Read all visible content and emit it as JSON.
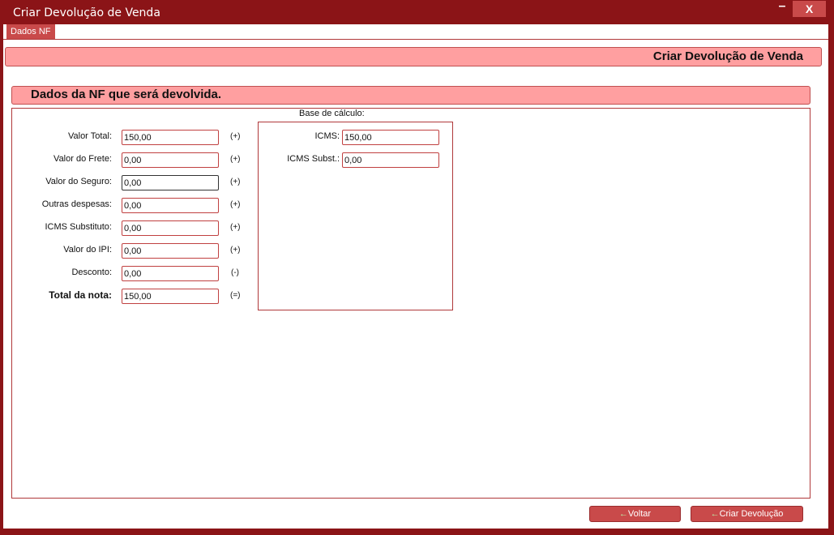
{
  "window": {
    "title": "Criar Devolução de Venda",
    "minimize": "–",
    "close": "X"
  },
  "tabs": [
    {
      "label": "Dados NF"
    }
  ],
  "header": {
    "title": "Criar Devolução de Venda"
  },
  "section": {
    "title": "Dados da NF que será devolvida."
  },
  "fields": [
    {
      "label": "Valor Total:",
      "value": "150,00",
      "op": "(+)"
    },
    {
      "label": "Valor do Frete:",
      "value": "0,00",
      "op": "(+)"
    },
    {
      "label": "Valor do Seguro:",
      "value": "0,00",
      "op": "(+)"
    },
    {
      "label": "Outras despesas:",
      "value": "0,00",
      "op": "(+)"
    },
    {
      "label": "ICMS Substituto:",
      "value": "0,00",
      "op": "(+)"
    },
    {
      "label": "Valor do IPI:",
      "value": "0,00",
      "op": "(+)"
    },
    {
      "label": "Desconto:",
      "value": "0,00",
      "op": "(-)"
    },
    {
      "label": "Total da nota:",
      "value": "150,00",
      "op": "(=)"
    }
  ],
  "base_calculo": {
    "legend": "Base de cálculo:",
    "fields": [
      {
        "label": "ICMS:",
        "value": "150,00"
      },
      {
        "label": "ICMS Subst.:",
        "value": "0,00"
      }
    ]
  },
  "buttons": {
    "back": "Voltar",
    "create": "Criar Devolução",
    "arrow_icon": "←"
  },
  "colors": {
    "frame": "#8b1417",
    "accent": "#ff9fa0",
    "button": "#c94a4a"
  }
}
